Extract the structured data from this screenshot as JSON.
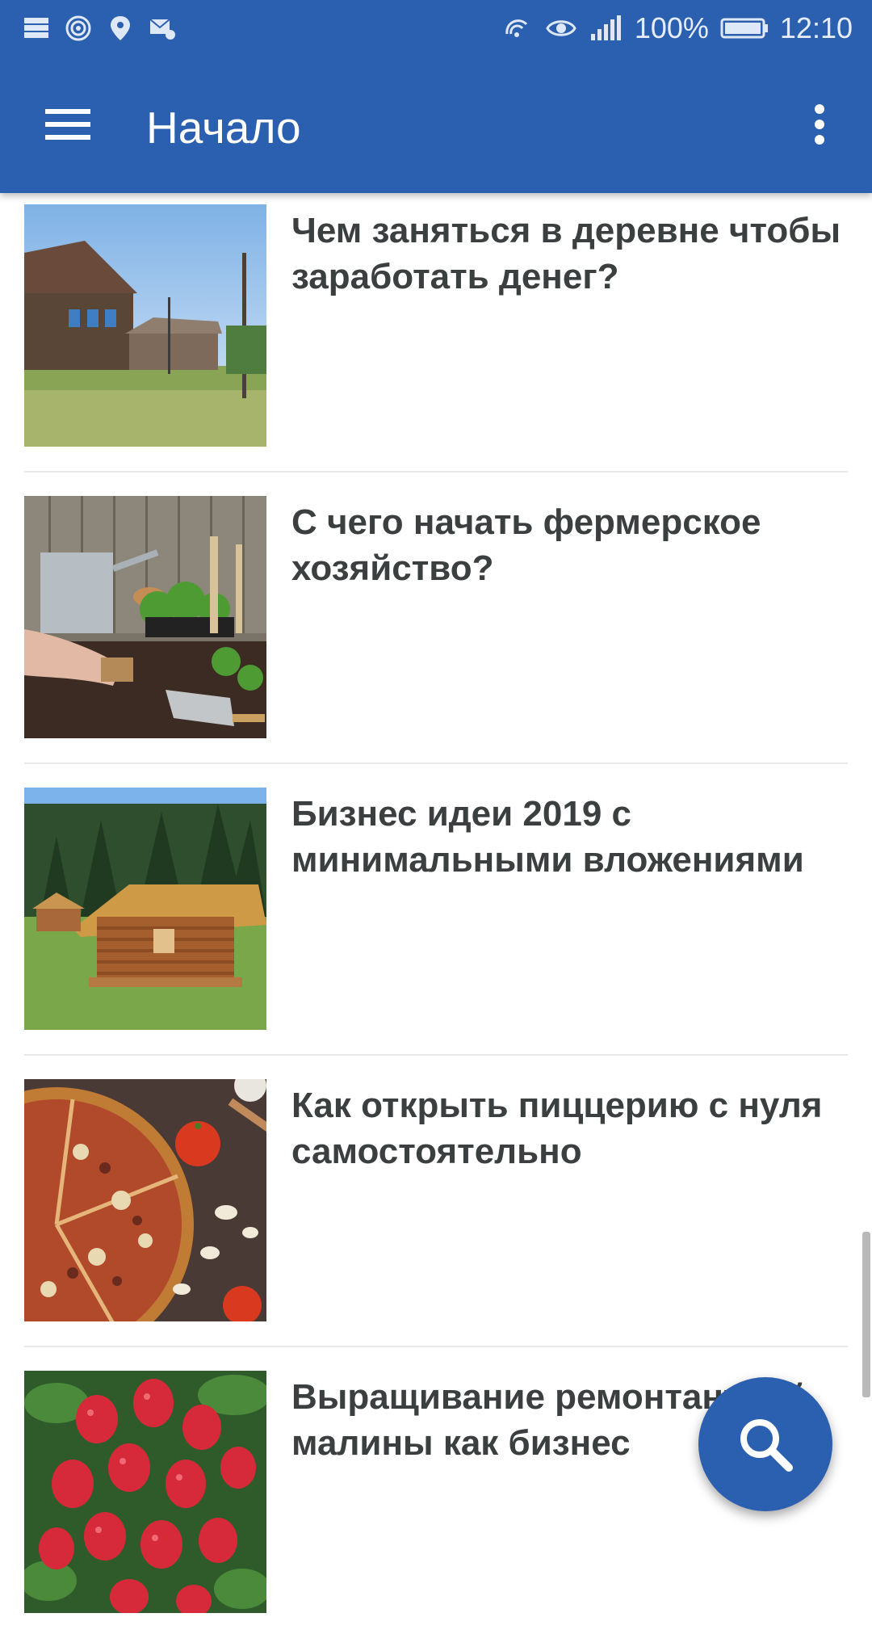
{
  "status_bar": {
    "battery": "100%",
    "time": "12:10",
    "left_icons": [
      "storage-icon",
      "hotspot-icon",
      "location-icon",
      "mail-settings-icon"
    ],
    "right_icons": [
      "wifi-call-icon",
      "eye-icon",
      "signal-icon",
      "battery-icon"
    ]
  },
  "app_bar": {
    "title": "Начало",
    "menu_icon": "hamburger-menu-icon",
    "overflow_icon": "more-vert-icon",
    "color": "#2b5faf"
  },
  "articles": [
    {
      "title": "Чем заняться в деревне чтобы заработать денег?"
    },
    {
      "title": "С чего начать фермерское хозяйство?"
    },
    {
      "title": "Бизнес идеи 2019 с минимальными вложениями"
    },
    {
      "title": "Как открыть пиццерию с нуля самостоятельно"
    },
    {
      "title": "Выращивание ремонтантной малины как бизнес"
    }
  ],
  "fab": {
    "icon": "search-icon",
    "color": "#2b5faf"
  }
}
